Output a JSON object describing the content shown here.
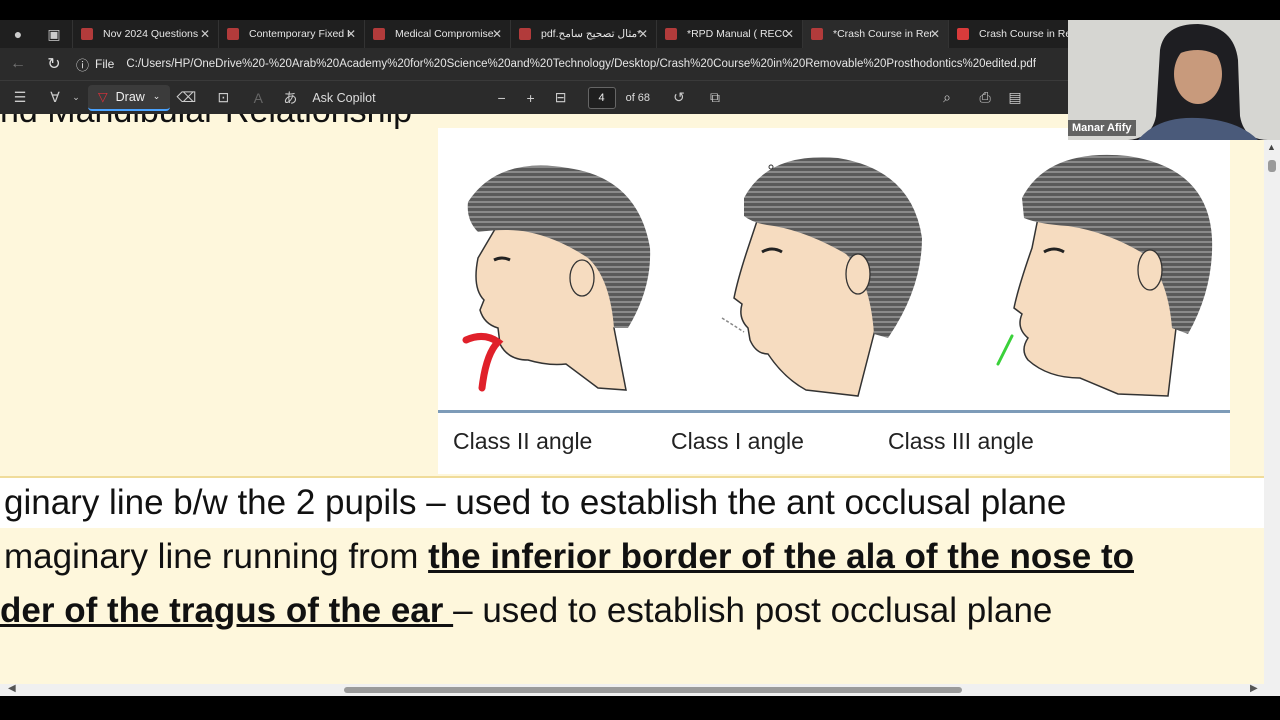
{
  "tabs": [
    {
      "label": "Nov 2024 Questions"
    },
    {
      "label": "Contemporary Fixed P"
    },
    {
      "label": "Medical Compromise"
    },
    {
      "label": "pdf.مثال تصحيح سامح*"
    },
    {
      "label": "*RPD Manual ( RECON"
    },
    {
      "label": "*Crash Course in Rem",
      "active": true
    },
    {
      "label": "Crash Course in Rem"
    }
  ],
  "address": {
    "file_label": "File",
    "url": "C:/Users/HP/OneDrive%20-%20Arab%20Academy%20for%20Science%20and%20Technology/Desktop/Crash%20Course%20in%20Removable%20Prosthodontics%20edited.pdf"
  },
  "pdf_toolbar": {
    "draw_label": "Draw",
    "ask_copilot_label": "Ask Copilot",
    "page_current": "4",
    "page_total": "of 68"
  },
  "page": {
    "heading_cut": "nd  Mandibular  Relationship",
    "captions": [
      "Class II angle",
      "Class I angle",
      "Class III angle"
    ],
    "line1": "ginary line b/w the 2 pupils – used to establish the ant occlusal plane",
    "line2_plain": "maginary line running from ",
    "line2_bold": "the inferior border of the ala of the nose to",
    "line3_bold": "der of the tragus of the ear ",
    "line3_plain": "– used to establish post occlusal plane"
  },
  "webcam": {
    "name": "Manar Afify"
  },
  "colors": {
    "page_bg": "#fef7dc",
    "toolbar_bg": "#2b2b2b",
    "annotation_red": "#e0202a",
    "annotation_green": "#3ad13a"
  }
}
